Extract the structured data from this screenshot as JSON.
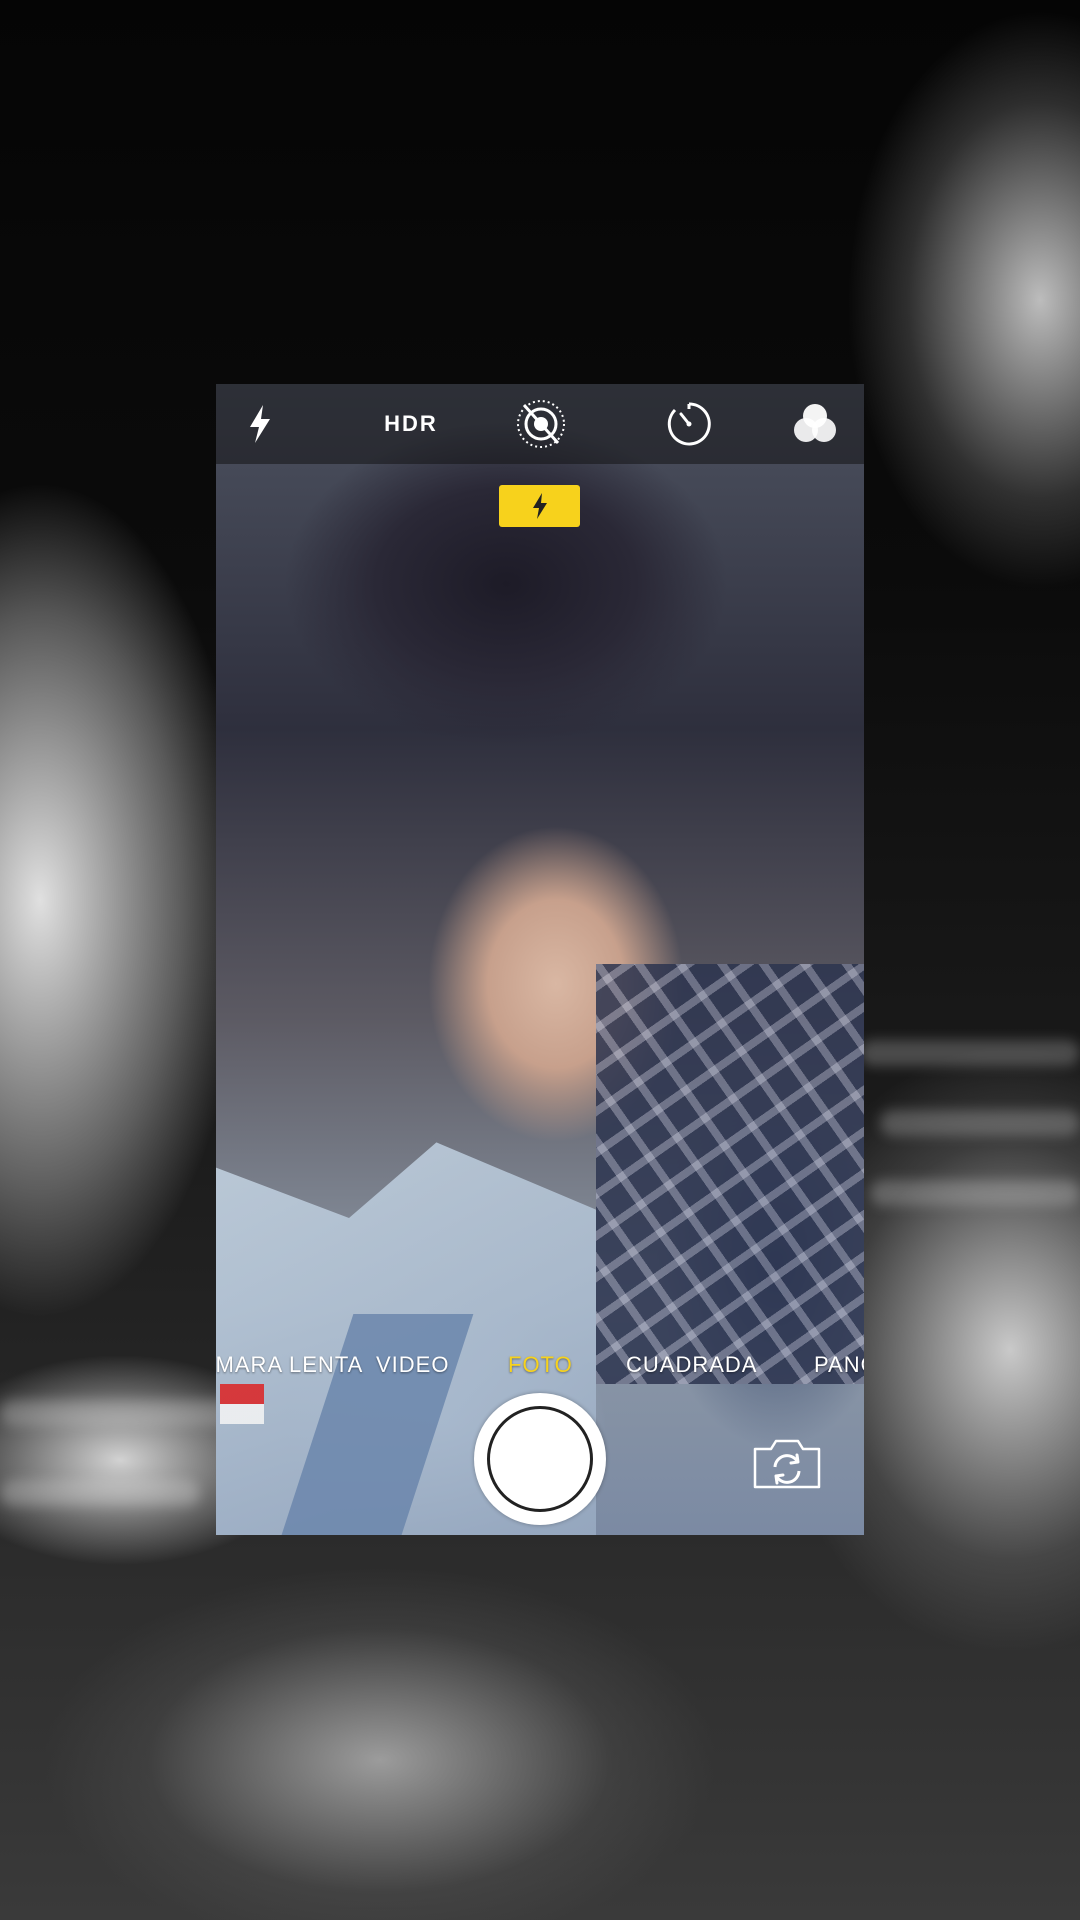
{
  "top_bar": {
    "flash_icon": "flash-icon",
    "hdr_label": "HDR",
    "live_photo_icon": "live-photo-off-icon",
    "timer_icon": "timer-icon",
    "filters_icon": "filters-icon"
  },
  "flash_indicator": {
    "icon": "flash-icon",
    "color": "#f7d21c"
  },
  "modes": {
    "items": [
      "CÁMARA LENTA",
      "VIDEO",
      "FOTO",
      "CUADRADA",
      "PANO"
    ],
    "active": "FOTO",
    "active_color": "#f7d21c"
  },
  "controls": {
    "shutter_icon": "shutter-button",
    "switch_camera_icon": "switch-camera-icon"
  }
}
